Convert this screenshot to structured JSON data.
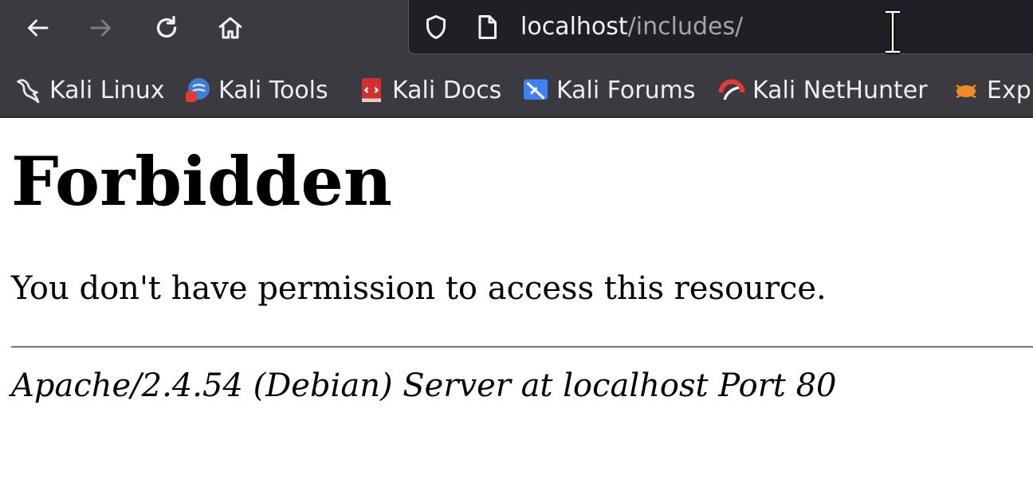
{
  "browser": {
    "url_host": "localhost",
    "url_path": "/includes/",
    "bookmarks": [
      {
        "label": "Kali Linux",
        "icon": "kali-dragon-icon"
      },
      {
        "label": "Kali Tools",
        "icon": "kali-tools-icon"
      },
      {
        "label": "Kali Docs",
        "icon": "kali-docs-icon"
      },
      {
        "label": "Kali Forums",
        "icon": "kali-forums-icon"
      },
      {
        "label": "Kali NetHunter",
        "icon": "kali-nethunter-icon"
      },
      {
        "label": "Exp",
        "icon": "exploit-db-icon"
      }
    ]
  },
  "page": {
    "title": "Forbidden",
    "message": "You don't have permission to access this resource.",
    "server_signature": "Apache/2.4.54 (Debian) Server at localhost Port 80"
  }
}
